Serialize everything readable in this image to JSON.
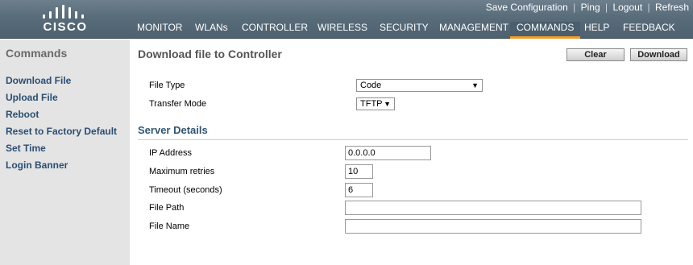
{
  "brand": {
    "logo_text": "CISCO"
  },
  "utility_links": [
    {
      "label": "Save Configuration"
    },
    {
      "label": "Ping"
    },
    {
      "label": "Logout"
    },
    {
      "label": "Refresh"
    }
  ],
  "main_nav": [
    {
      "label": "MONITOR",
      "active": false
    },
    {
      "label": "WLANs",
      "active": false
    },
    {
      "label": "CONTROLLER",
      "active": false
    },
    {
      "label": "WIRELESS",
      "active": false
    },
    {
      "label": "SECURITY",
      "active": false
    },
    {
      "label": "MANAGEMENT",
      "active": false
    },
    {
      "label": "COMMANDS",
      "active": true
    },
    {
      "label": "HELP",
      "active": false
    },
    {
      "label": "FEEDBACK",
      "active": false
    }
  ],
  "sidebar": {
    "title": "Commands",
    "items": [
      {
        "label": "Download File"
      },
      {
        "label": "Upload File"
      },
      {
        "label": "Reboot"
      },
      {
        "label": "Reset to Factory Default"
      },
      {
        "label": "Set Time"
      },
      {
        "label": "Login Banner"
      }
    ]
  },
  "page": {
    "title": "Download file to Controller",
    "buttons": {
      "clear": "Clear",
      "download": "Download"
    },
    "file_type": {
      "label": "File Type",
      "value": "Code"
    },
    "transfer_mode": {
      "label": "Transfer Mode",
      "value": "TFTP"
    },
    "server_details": {
      "title": "Server Details",
      "ip_address": {
        "label": "IP Address",
        "value": "0.0.0.0"
      },
      "max_retries": {
        "label": "Maximum retries",
        "value": "10"
      },
      "timeout": {
        "label": "Timeout (seconds)",
        "value": "6"
      },
      "file_path": {
        "label": "File Path",
        "value": ""
      },
      "file_name": {
        "label": "File Name",
        "value": ""
      }
    }
  },
  "colors": {
    "header_bg": "#596c7a",
    "active_tab_underline": "#f09a25",
    "sidebar_bg": "#e4e4e4",
    "sidebar_link": "#2a4e73",
    "section_title": "#2f5573"
  }
}
